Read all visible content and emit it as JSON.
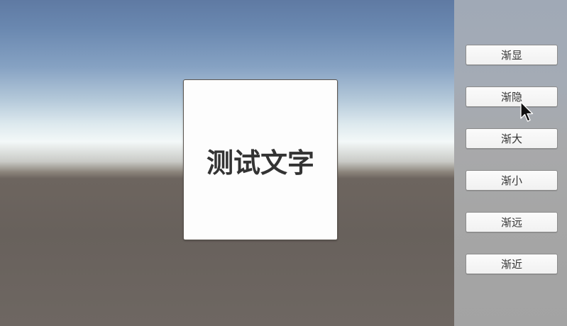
{
  "scene": {
    "panel_text": "测试文字"
  },
  "sidebar": {
    "buttons": [
      {
        "label": "渐显"
      },
      {
        "label": "渐隐"
      },
      {
        "label": "渐大"
      },
      {
        "label": "渐小"
      },
      {
        "label": "渐远"
      },
      {
        "label": "渐近"
      }
    ]
  },
  "cursor": {
    "icon": "arrow-cursor-icon",
    "hovering": "渐隐"
  },
  "colors": {
    "panel_text": "#333333",
    "button_text": "#333333",
    "sidebar_bg": "#a6a6a6"
  }
}
